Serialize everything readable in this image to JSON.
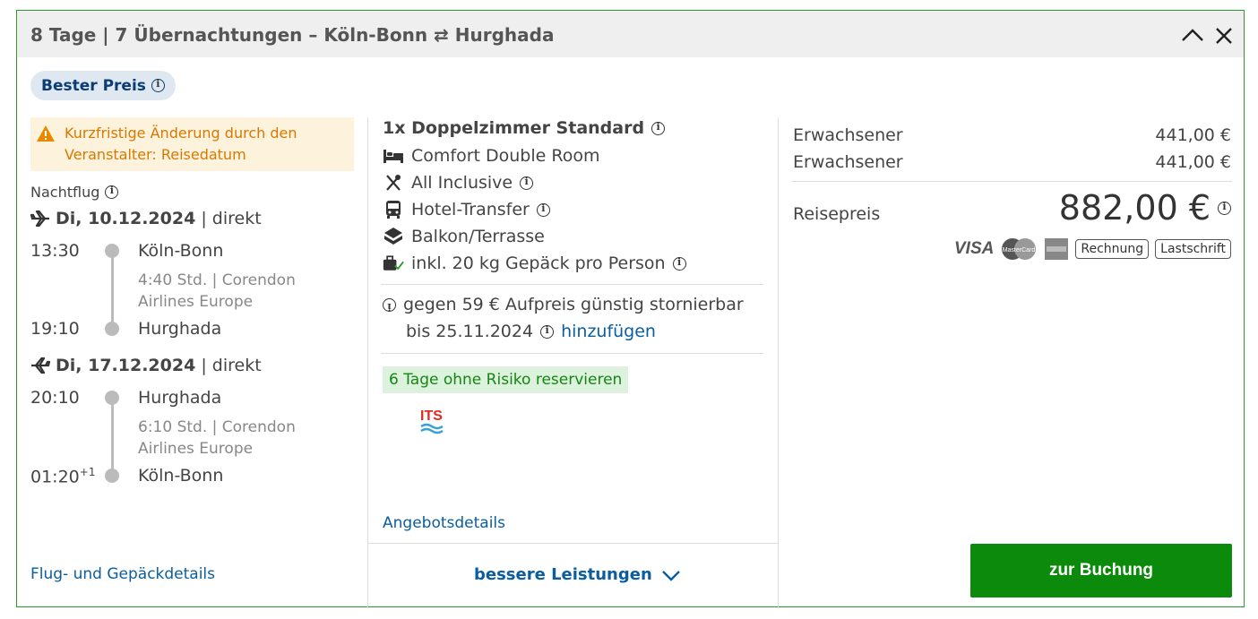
{
  "header": {
    "title": "8 Tage | 7 Übernachtungen – Köln-Bonn ⇄ Hurghada"
  },
  "badge": {
    "label": "Bester Preis"
  },
  "warning": {
    "text": "Kurzfristige Änderung durch den Veranstalter: Reisedatum"
  },
  "flight": {
    "night_label": "Nachtflug",
    "outbound": {
      "date": "Di, 10.12.2024",
      "type": "| direkt",
      "dep_time": "13:30",
      "dep_place": "Köln-Bonn",
      "duration": "4:40 Std. | Corendon",
      "airline": "Airlines Europe",
      "arr_time": "19:10",
      "arr_place": "Hurghada"
    },
    "return": {
      "date": "Di, 17.12.2024",
      "type": "| direkt",
      "dep_time": "20:10",
      "dep_place": "Hurghada",
      "duration": "6:10 Std. | Corendon",
      "airline": "Airlines Europe",
      "arr_time": "01:20",
      "arr_plus": "+1",
      "arr_place": "Köln-Bonn"
    },
    "details_link": "Flug- und Gepäckdetails"
  },
  "offer": {
    "room_title": "1x Doppelzimmer Standard",
    "features": [
      {
        "icon": "bed-icon",
        "label": "Comfort Double Room"
      },
      {
        "icon": "cutlery-icon",
        "label": "All Inclusive"
      },
      {
        "icon": "bus-icon",
        "label": "Hotel-Transfer"
      },
      {
        "icon": "balcony-icon",
        "label": "Balkon/Terrasse"
      },
      {
        "icon": "luggage-icon",
        "label": "inkl. 20 kg Gepäck pro Person"
      }
    ],
    "cancel_line1": "gegen 59 € Aufpreis günstig stornierbar",
    "cancel_line2": "bis 25.11.2024",
    "cancel_add": "hinzufügen",
    "reserve_tag": "6 Tage ohne Risiko reservieren",
    "operator_logo": "ITS",
    "details_link": "Angebotsdetails",
    "better_link": "bessere Leistungen"
  },
  "price": {
    "rows": [
      {
        "label": "Erwachsener",
        "value": "441,00 €"
      },
      {
        "label": "Erwachsener",
        "value": "441,00 €"
      }
    ],
    "total_label": "Reisepreis",
    "total_value": "882,00 €",
    "payment": [
      "VISA",
      "MasterCard",
      "American Express",
      "Rechnung",
      "Lastschrift"
    ],
    "book_button": "zur Buchung"
  },
  "colors": {
    "accent_green": "#0b8a0b",
    "link_blue": "#0a5ea0",
    "warning_orange": "#d97800",
    "border_green": "#2e9a2e"
  }
}
